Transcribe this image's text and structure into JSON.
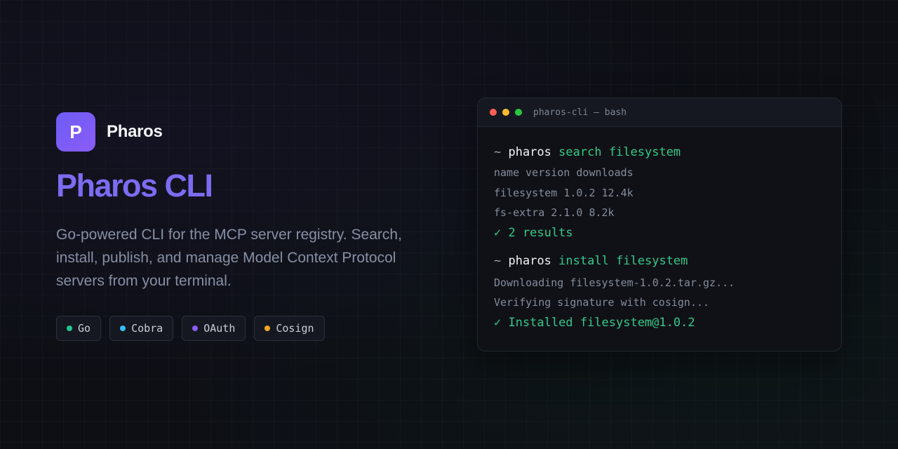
{
  "brand": {
    "logo_letter": "P",
    "name": "Pharos",
    "logo_color": "#7c5cf6"
  },
  "hero": {
    "title": "Pharos CLI",
    "description": "Go-powered CLI for the MCP server registry. Search, install, publish, and manage Model Context Protocol servers from your terminal.",
    "title_color": "#7c6cf2"
  },
  "tags": [
    {
      "label": "Go",
      "color": "#22c58e"
    },
    {
      "label": "Cobra",
      "color": "#38bdf8"
    },
    {
      "label": "OAuth",
      "color": "#8b5cf6"
    },
    {
      "label": "Cosign",
      "color": "#f5a524"
    }
  ],
  "terminal": {
    "title": "pharos-cli — bash",
    "traffic_lights": [
      "#ff5f57",
      "#febc2e",
      "#28c840"
    ],
    "prompt": "~",
    "commands": [
      {
        "binary": "pharos",
        "args": "search filesystem",
        "output": [
          "name version downloads",
          "filesystem 1.0.2 12.4k",
          "fs-extra 2.1.0 8.2k"
        ],
        "success": "✓ 2 results"
      },
      {
        "binary": "pharos",
        "args": "install filesystem",
        "output": [
          "Downloading filesystem-1.0.2.tar.gz...",
          "Verifying signature with cosign..."
        ],
        "success": "✓ Installed filesystem@1.0.2"
      }
    ]
  }
}
